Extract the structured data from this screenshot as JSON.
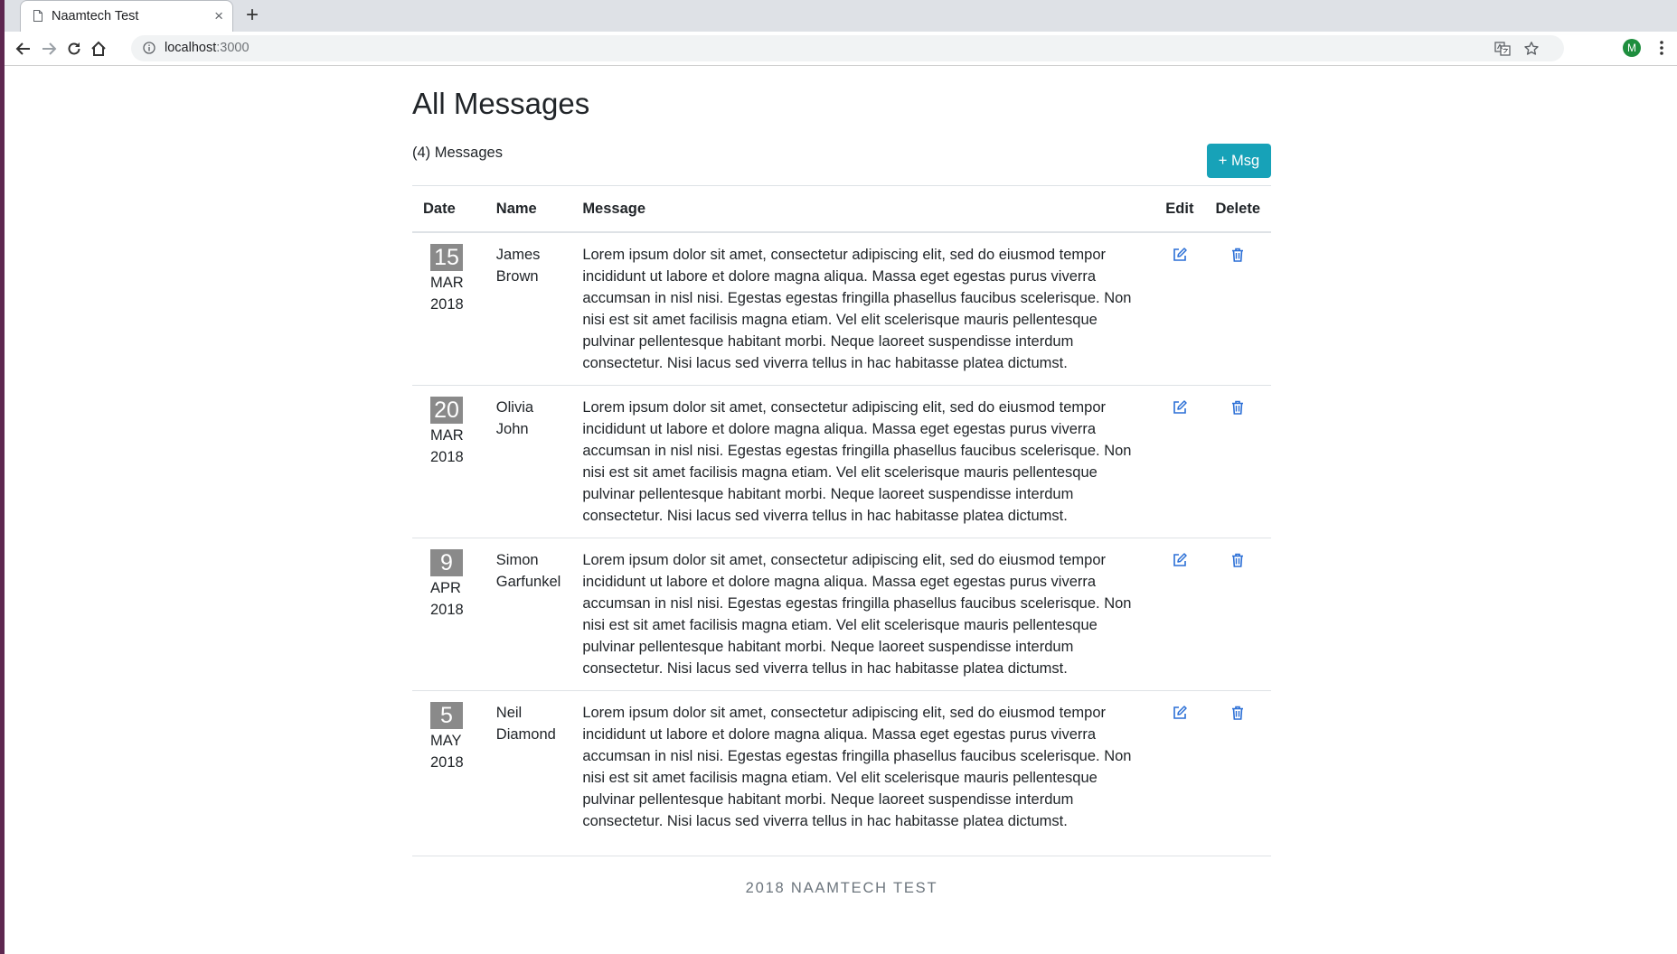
{
  "browser": {
    "tab_title": "Naamtech Test",
    "tab_close": "×",
    "new_tab": "+",
    "url_host": "localhost",
    "url_port": ":3000",
    "profile_initial": "M"
  },
  "page": {
    "title": "All Messages",
    "count_text": "(4) Messages",
    "add_button_label": "+ Msg"
  },
  "table": {
    "headers": {
      "date": "Date",
      "name": "Name",
      "message": "Message",
      "edit": "Edit",
      "delete": "Delete"
    },
    "rows": [
      {
        "day": "15",
        "month": "MAR",
        "year": "2018",
        "name": "James Brown",
        "message": "Lorem ipsum dolor sit amet, consectetur adipiscing elit, sed do eiusmod tempor incididunt ut labore et dolore magna aliqua. Massa eget egestas purus viverra accumsan in nisl nisi. Egestas egestas fringilla phasellus faucibus scelerisque. Non nisi est sit amet facilisis magna etiam. Vel elit scelerisque mauris pellentesque pulvinar pellentesque habitant morbi. Neque laoreet suspendisse interdum consectetur. Nisi lacus sed viverra tellus in hac habitasse platea dictumst."
      },
      {
        "day": "20",
        "month": "MAR",
        "year": "2018",
        "name": "Olivia John",
        "message": "Lorem ipsum dolor sit amet, consectetur adipiscing elit, sed do eiusmod tempor incididunt ut labore et dolore magna aliqua. Massa eget egestas purus viverra accumsan in nisl nisi. Egestas egestas fringilla phasellus faucibus scelerisque. Non nisi est sit amet facilisis magna etiam. Vel elit scelerisque mauris pellentesque pulvinar pellentesque habitant morbi. Neque laoreet suspendisse interdum consectetur. Nisi lacus sed viverra tellus in hac habitasse platea dictumst."
      },
      {
        "day": "9",
        "month": "APR",
        "year": "2018",
        "name": "Simon Garfunkel",
        "message": "Lorem ipsum dolor sit amet, consectetur adipiscing elit, sed do eiusmod tempor incididunt ut labore et dolore magna aliqua. Massa eget egestas purus viverra accumsan in nisl nisi. Egestas egestas fringilla phasellus faucibus scelerisque. Non nisi est sit amet facilisis magna etiam. Vel elit scelerisque mauris pellentesque pulvinar pellentesque habitant morbi. Neque laoreet suspendisse interdum consectetur. Nisi lacus sed viverra tellus in hac habitasse platea dictumst."
      },
      {
        "day": "5",
        "month": "MAY",
        "year": "2018",
        "name": "Neil Diamond",
        "message": "Lorem ipsum dolor sit amet, consectetur adipiscing elit, sed do eiusmod tempor incididunt ut labore et dolore magna aliqua. Massa eget egestas purus viverra accumsan in nisl nisi. Egestas egestas fringilla phasellus faucibus scelerisque. Non nisi est sit amet facilisis magna etiam. Vel elit scelerisque mauris pellentesque pulvinar pellentesque habitant morbi. Neque laoreet suspendisse interdum consectetur. Nisi lacus sed viverra tellus in hac habitasse platea dictumst."
      }
    ]
  },
  "footer": {
    "text": "2018 NAAMTECH TEST"
  },
  "icons": {
    "back": "back-arrow-icon",
    "forward": "forward-arrow-icon",
    "reload": "reload-icon",
    "home": "home-icon",
    "info": "info-icon",
    "translate": "translate-icon",
    "bookmark": "star-icon",
    "menu": "more-vertical-icon",
    "edit": "edit-icon",
    "delete": "trash-icon"
  },
  "colors": {
    "accent": "#17a2b8",
    "link_icon": "#2b6fd6",
    "date_box": "#8a8a8a",
    "footer_text": "#6c757d"
  }
}
